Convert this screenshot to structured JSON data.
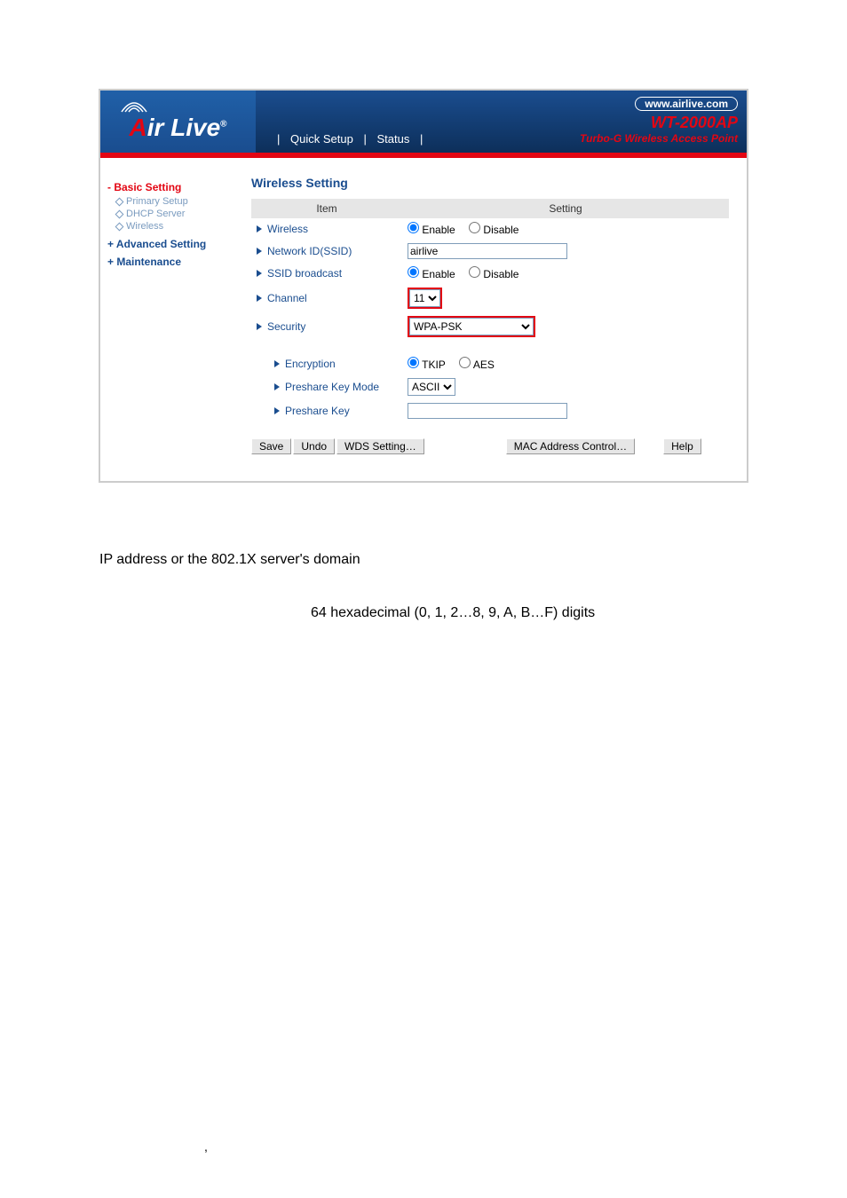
{
  "header": {
    "url": "www.airlive.com",
    "model": "WT-2000AP",
    "model_desc": "Turbo-G Wireless Access Point",
    "nav": {
      "quick_setup": "Quick Setup",
      "status": "Status"
    },
    "logo_suffix": "ir Live"
  },
  "sidebar": {
    "basic": {
      "label": "- Basic Setting",
      "items": [
        "Primary Setup",
        "DHCP Server",
        "Wireless"
      ]
    },
    "advanced": "+ Advanced Setting",
    "maintenance": "+ Maintenance"
  },
  "main": {
    "title": "Wireless Setting",
    "headers": {
      "item": "Item",
      "setting": "Setting"
    },
    "rows": {
      "wireless": "Wireless",
      "ssid": "Network ID(SSID)",
      "ssid_bcast": "SSID broadcast",
      "channel": "Channel",
      "security": "Security",
      "encryption": "Encryption",
      "psk_mode": "Preshare Key Mode",
      "psk": "Preshare Key"
    },
    "values": {
      "enable": "Enable",
      "disable": "Disable",
      "ssid_value": "airlive",
      "channel_value": "11",
      "security_value": "WPA-PSK",
      "tkip": "TKIP",
      "aes": "AES",
      "psk_mode_value": "ASCII",
      "psk_value": ""
    },
    "buttons": {
      "save": "Save",
      "undo": "Undo",
      "wds": "WDS Setting…",
      "mac": "MAC Address Control…",
      "help": "Help"
    }
  },
  "below": {
    "line1": "IP address or the 802.1X server's domain",
    "line2": "64 hexadecimal (0, 1, 2…8, 9, A, B…F) digits"
  },
  "misc": {
    "comma": ","
  }
}
